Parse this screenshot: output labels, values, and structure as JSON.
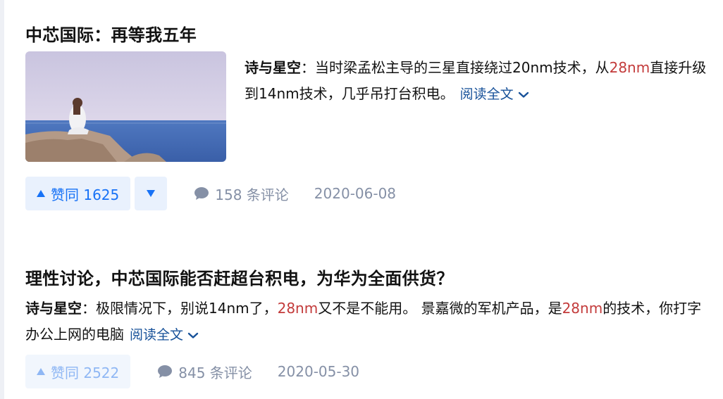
{
  "feed": [
    {
      "title": "中芯国际：再等我五年",
      "author": "诗与星空",
      "sep": "：",
      "text_a": "当时梁孟松主导的三星直接绕过20nm技术，从",
      "hl_1": "28nm",
      "text_b": "直接升级到14nm技术，几乎吊打台积电。",
      "read_more": "阅读全文",
      "upvote": "赞同 1625",
      "comments": "158 条评论",
      "date": "2020-06-08"
    },
    {
      "title": "理性讨论，中芯国际能否赶超台积电，为华为全面供货？",
      "author": "诗与星空",
      "sep": "：",
      "text_a": "极限情况下，别说14nm了，",
      "hl_1": "28nm",
      "text_b": "又不是不能用。 景嘉微的军机产品，是",
      "hl_2": "28nm",
      "text_c": "的技术，你打字办公上网的电脑",
      "read_more": "阅读全文",
      "upvote": "赞同 2522",
      "comments": "845 条评论",
      "date": "2020-05-30"
    }
  ],
  "icons": {
    "upvote": "triangle-up-icon",
    "downvote": "triangle-down-icon",
    "comment": "comment-bubble-icon",
    "expand": "chevron-down-icon"
  },
  "colors": {
    "link": "#175199",
    "vote": "#1772f6",
    "vote_bg": "#e9f1fd",
    "highlight": "#c33b3b",
    "meta": "#8590a6"
  }
}
